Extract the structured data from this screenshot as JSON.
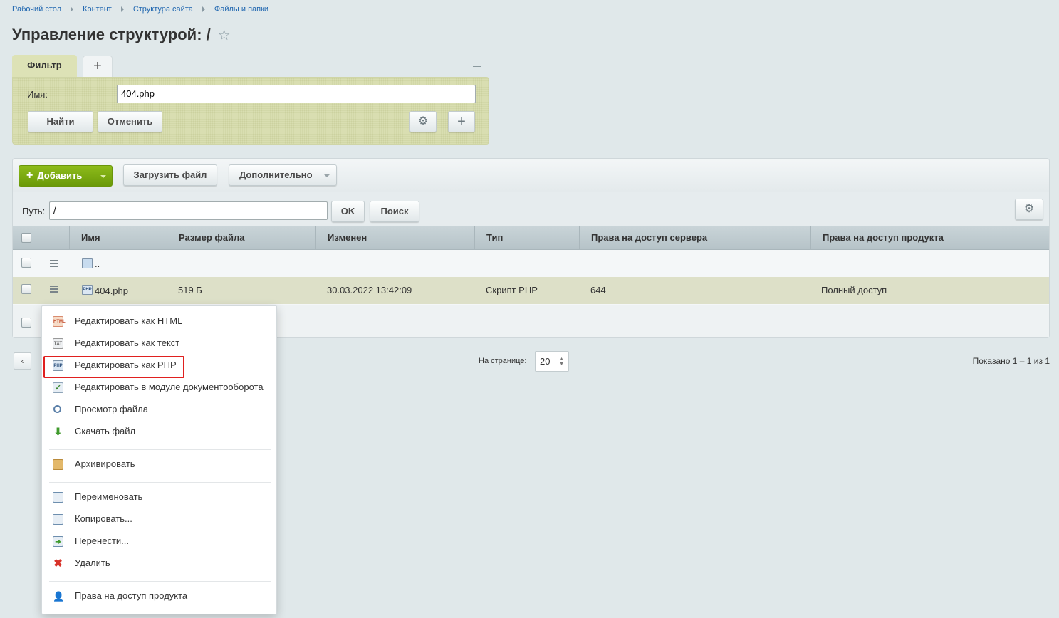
{
  "breadcrumb": [
    "Рабочий стол",
    "Контент",
    "Структура сайта",
    "Файлы и папки"
  ],
  "page_title": "Управление структурой: /",
  "filter": {
    "tab_label": "Фильтр",
    "add_tab_symbol": "+",
    "name_label": "Имя:",
    "name_value": "404.php",
    "find_label": "Найти",
    "cancel_label": "Отменить"
  },
  "toolbar": {
    "add_label": "Добавить",
    "upload_label": "Загрузить файл",
    "more_label": "Дополнительно",
    "path_label": "Путь:",
    "path_value": "/",
    "ok_label": "OK",
    "search_label": "Поиск"
  },
  "table": {
    "columns": [
      "Имя",
      "Размер файла",
      "Изменен",
      "Тип",
      "Права на доступ сервера",
      "Права на доступ продукта"
    ],
    "parent_row": {
      "name": ".."
    },
    "file_row": {
      "name": "404.php",
      "size": "519 Б",
      "modified": "30.03.2022 13:42:09",
      "type": "Скрипт PHP",
      "server_access": "644",
      "product_access": "Полный доступ"
    }
  },
  "pagination": {
    "per_page_label": "На странице:",
    "per_page_value": "20",
    "shown_label": "Показано 1 – 1 из 1"
  },
  "context_menu": {
    "items": [
      "Редактировать как HTML",
      "Редактировать как текст",
      "Редактировать как PHP",
      "Редактировать в модуле документооборота",
      "Просмотр файла",
      "Скачать файл",
      "Архивировать",
      "Переименовать",
      "Копировать...",
      "Перенести...",
      "Удалить",
      "Права на доступ продукта"
    ],
    "icon_texts": {
      "html": "HTML",
      "txt": "TXT",
      "php": "PHP"
    }
  },
  "colors": {
    "accent_green": "#7aab12",
    "filter_bg": "#d9deb1",
    "selected_row": "#dde0c8",
    "highlight_red": "#e0201f"
  }
}
